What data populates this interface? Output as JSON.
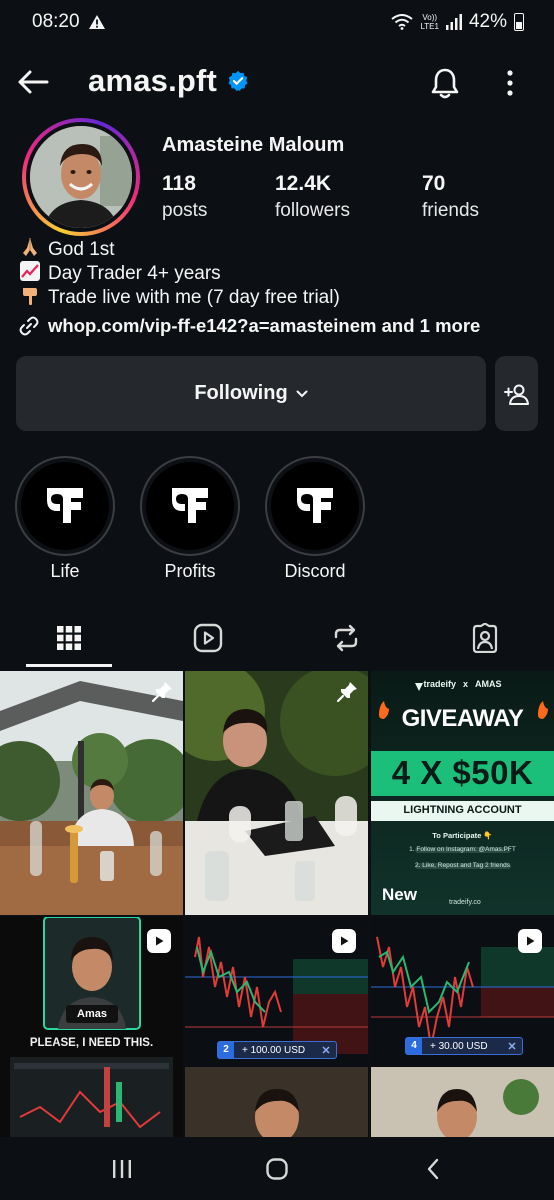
{
  "status_bar": {
    "time": "08:20",
    "network": "Vo)) LTE1",
    "network_top": "Vo))",
    "network_bottom": "LTE1",
    "battery": "42%"
  },
  "header": {
    "username": "amas.pft",
    "verified": true
  },
  "profile": {
    "display_name": "Amasteine Maloum",
    "stats": [
      {
        "value": "118",
        "label": "posts"
      },
      {
        "value": "12.4K",
        "label": "followers"
      },
      {
        "value": "70",
        "label": "friends"
      }
    ],
    "bio": [
      {
        "icon": "praying-hands-icon",
        "text": "God 1st"
      },
      {
        "icon": "chart-increasing-icon",
        "text": "Day Trader 4+ years"
      },
      {
        "icon": "pointing-down-icon",
        "text": "Trade live with me (7 day free trial)"
      }
    ],
    "link": "whop.com/vip-ff-e142?a=amasteinem and 1 more"
  },
  "actions": {
    "following_label": "Following"
  },
  "highlights": [
    {
      "label": "Life"
    },
    {
      "label": "Profits"
    },
    {
      "label": "Discord"
    }
  ],
  "grid": {
    "posts": [
      {
        "type": "photo",
        "pinned": true
      },
      {
        "type": "photo",
        "pinned": true
      },
      {
        "type": "promo",
        "brand": "tradeify",
        "times": "x",
        "partner": "AMAS",
        "headline": "GIVEAWAY",
        "amount": "4 X $50K",
        "subtitle": "LIGHTNING ACCOUNT",
        "to_participate": "To Participate 👇",
        "step1": "1. Follow on Instagram: @Amas.PFT",
        "step2": "2. Like, Repost and Tag 2 friends",
        "badge": "New",
        "url": "tradeify.co"
      },
      {
        "type": "reel",
        "name_tag": "Amas",
        "caption": "PLEASE, I NEED THIS."
      },
      {
        "type": "reel",
        "order_no": "2",
        "order_value": "+ 100.00 USD"
      },
      {
        "type": "reel",
        "order_no": "4",
        "order_value": "+ 30.00 USD"
      }
    ]
  },
  "colors": {
    "background": "#0c1014",
    "button": "#25292e",
    "verified": "#0095f6",
    "ring_start": "#f9ce34",
    "ring_end": "#6228d7"
  }
}
